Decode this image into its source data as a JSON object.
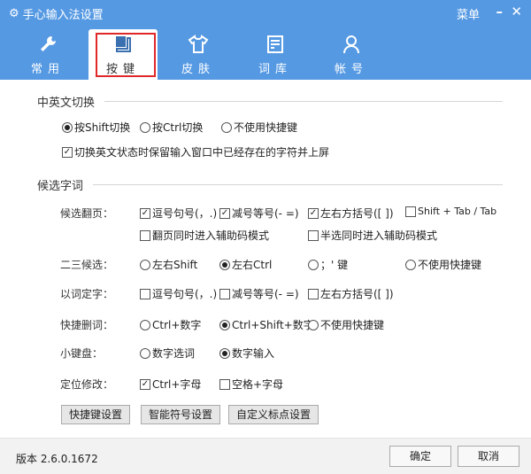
{
  "window": {
    "title": "手心输入法设置",
    "menu": "菜单",
    "minimize": "–",
    "close": "✕"
  },
  "tabs": [
    {
      "label": "常用"
    },
    {
      "label": "按键"
    },
    {
      "label": "皮肤"
    },
    {
      "label": "词库"
    },
    {
      "label": "帐号"
    }
  ],
  "sections": {
    "lang_switch": "中英文切换",
    "candidates": "候选字词"
  },
  "lang": {
    "opts": [
      "按Shift切换",
      "按Ctrl切换",
      "不使用快捷键"
    ],
    "keep": "切换英文状态时保留输入窗口中已经存在的字符并上屏"
  },
  "rows": {
    "page": {
      "label": "候选翻页：",
      "opts": [
        "逗号句号(，.)",
        "减号等号(- =)",
        "左右方括号([ ])",
        "Shift + Tab / Tab",
        "翻页同时进入辅助码模式",
        "半选同时进入辅助码模式"
      ]
    },
    "second": {
      "label": "二三候选：",
      "opts": [
        "左右Shift",
        "左右Ctrl",
        "；' 键",
        "不使用快捷键"
      ]
    },
    "word": {
      "label": "以词定字：",
      "opts": [
        "逗号句号(，.)",
        "减号等号(- =)",
        "左右方括号([ ])"
      ]
    },
    "del": {
      "label": "快捷删词：",
      "opts": [
        "Ctrl+数字",
        "Ctrl+Shift+数字",
        "不使用快捷键"
      ]
    },
    "numpad": {
      "label": "小键盘：",
      "opts": [
        "数字选词",
        "数字输入"
      ]
    },
    "locate": {
      "label": "定位修改：",
      "opts": [
        "Ctrl+字母",
        "空格+字母"
      ]
    }
  },
  "buttons": [
    "快捷键设置",
    "智能符号设置",
    "自定义标点设置"
  ],
  "footer": {
    "version": "版本 2.6.0.1672",
    "ok": "确定",
    "cancel": "取消"
  }
}
